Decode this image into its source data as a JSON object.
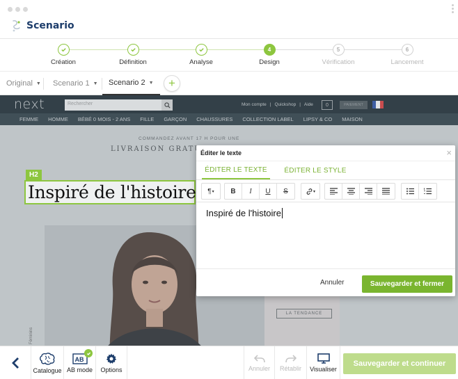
{
  "app": {
    "name": "Scenario"
  },
  "steps": [
    {
      "label": "Création",
      "state": "done",
      "number": "1"
    },
    {
      "label": "Définition",
      "state": "done",
      "number": "2"
    },
    {
      "label": "Analyse",
      "state": "done",
      "number": "3"
    },
    {
      "label": "Design",
      "state": "active",
      "number": "4"
    },
    {
      "label": "Vérification",
      "state": "todo",
      "number": "5"
    },
    {
      "label": "Lancement",
      "state": "todo",
      "number": "6"
    }
  ],
  "tabs": [
    {
      "label": "Original",
      "active": false
    },
    {
      "label": "Scenario 1",
      "active": false
    },
    {
      "label": "Scenario 2",
      "active": true
    }
  ],
  "site": {
    "logo": "next",
    "search_placeholder": "Rechercher",
    "links": [
      "Mon compte",
      "|",
      "Quickshop",
      "|",
      "Aide"
    ],
    "bag_count": "0",
    "pay_label": "PAIEMENT",
    "nav": [
      "FEMME",
      "HOMME",
      "BÉBÉ 0 MOIS - 2 ANS",
      "FILLE",
      "GARÇON",
      "CHAUSSURES",
      "COLLECTION LABEL",
      "LIPSY & CO",
      "MAISON"
    ],
    "promo_line1": "COMMANDEZ AVANT 17 H POUR UNE",
    "promo_line2": "LIVRAISON GRATU",
    "tendance": "LA TENDANCE",
    "side_text": "Féminins"
  },
  "selection": {
    "tag": "H2",
    "heading_text": "Inspiré de l'histoire"
  },
  "modal": {
    "title": "Éditer le texte",
    "tab_text": "ÉDITER LE TEXTE",
    "tab_style": "ÉDITER LE STYLE",
    "toolbar": {
      "paragraph": "¶",
      "bold": "B",
      "italic": "I",
      "underline": "U",
      "strike": "S",
      "link_icon": "link-icon",
      "align_left_icon": "align-left-icon",
      "align_center_icon": "align-center-icon",
      "align_right_icon": "align-right-icon",
      "justify_icon": "align-justify-icon",
      "bullets_icon": "bullet-list-icon",
      "numbers_icon": "numbered-list-icon"
    },
    "content": "Inspiré de l'histoire",
    "cancel": "Annuler",
    "save": "Sauvegarder et fermer"
  },
  "bottom": {
    "catalogue": "Catalogue",
    "abmode": "AB mode",
    "options": "Options",
    "undo": "Annuler",
    "redo": "Rétablir",
    "preview": "Visualiser",
    "save_continue": "Sauvegarder et continuer"
  },
  "colors": {
    "accent": "#8dc63f",
    "accent_dark": "#7ab52f",
    "brand_text": "#1d3d6b",
    "site_header": "#1e2a31",
    "site_nav": "#2e3c44"
  }
}
